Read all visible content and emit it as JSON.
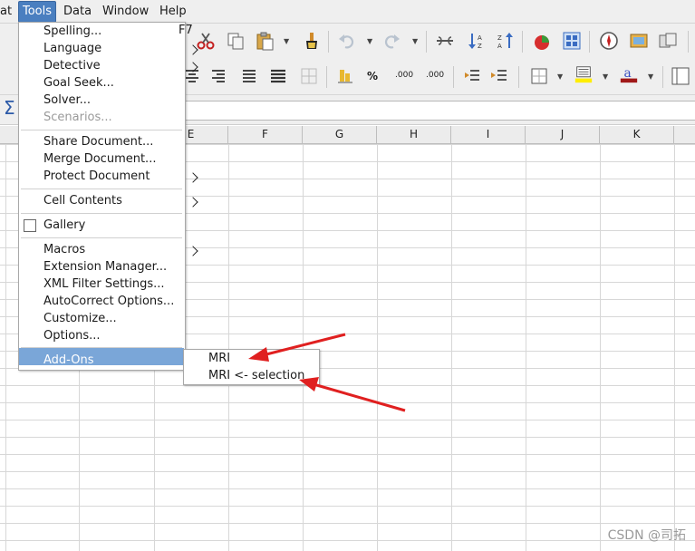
{
  "menubar": {
    "items": [
      "at",
      "Tools",
      "Data",
      "Window",
      "Help"
    ]
  },
  "columns": [
    "E",
    "F",
    "G",
    "H",
    "I",
    "J",
    "K"
  ],
  "tools_menu": {
    "spelling": "Spelling...",
    "spelling_shortcut": "F7",
    "language": "Language",
    "detective": "Detective",
    "goal_seek": "Goal Seek...",
    "solver": "Solver...",
    "scenarios": "Scenarios...",
    "share_document": "Share Document...",
    "merge_document": "Merge Document...",
    "protect_document": "Protect Document",
    "cell_contents": "Cell Contents",
    "gallery": "Gallery",
    "macros": "Macros",
    "extension_manager": "Extension Manager...",
    "xml_filter_settings": "XML Filter Settings...",
    "autocorrect_options": "AutoCorrect Options...",
    "customize": "Customize...",
    "options": "Options...",
    "add_ons": "Add-Ons"
  },
  "addons_submenu": {
    "mri": "MRI",
    "mri_selection": "MRI <- selection"
  },
  "toolbar2": {
    "percent_label": "%",
    "decimal_add_label": ".000",
    "decimal_del_label": ".000"
  },
  "formula_bar": {
    "sigma": "Σ"
  },
  "watermark": "CSDN @司拓",
  "colors": {
    "menu_highlight": "#7aa6d8",
    "tools_active": "#4a7fc0",
    "arrow_red": "#e02020"
  }
}
